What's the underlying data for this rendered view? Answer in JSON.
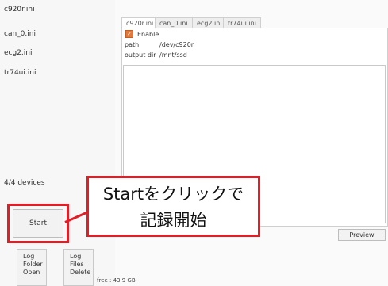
{
  "sidebar": {
    "files": [
      "c920r.ini",
      "can_0.ini",
      "ecg2.ini",
      "tr74ui.ini"
    ],
    "devices_label": "4/4 devices",
    "start_label": "Start",
    "log_folder_open": [
      "Log",
      "Folder",
      "Open"
    ],
    "log_files_delete": [
      "Log",
      "Files",
      "Delete"
    ],
    "free_label": "free : 43.9 GB"
  },
  "tabs": [
    "c920r.ini",
    "can_0.ini",
    "ecg2.ini",
    "tr74ui.ini"
  ],
  "active_tab": "c920r.ini",
  "settings": {
    "enable_label": "Enable",
    "enabled": true,
    "path_label": "path",
    "path_value": "/dev/c920r",
    "output_dir_label": "output dir",
    "output_dir_value": "/mnt/ssd"
  },
  "preview_label": "Preview",
  "callout": {
    "line1": "Startをクリックで",
    "line2": "記録開始"
  },
  "colors": {
    "highlight": "#e11d26",
    "checkbox": "#e07a3c"
  }
}
